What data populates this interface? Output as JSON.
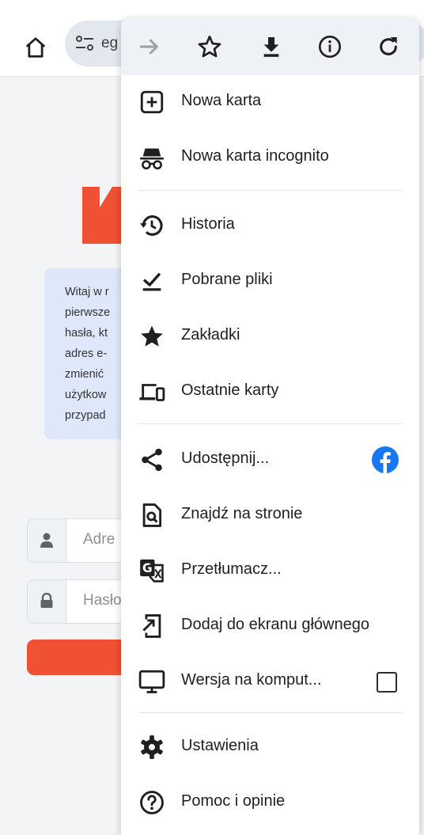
{
  "browser": {
    "url_text": "eg",
    "icons": {
      "home": "home-icon",
      "site_settings": "tune-icon",
      "forward": "arrow-forward-icon",
      "bookmark": "star-outline-icon",
      "download": "download-icon",
      "info": "info-icon",
      "reload": "reload-icon"
    }
  },
  "page": {
    "welcome_lines": [
      "Witaj w r",
      "pierwsze",
      "hasła, kt",
      "adres e-",
      "zmienić ",
      "użytkow",
      "przypad"
    ],
    "email_placeholder": "Adre",
    "password_placeholder": "Hasło",
    "brand_color": "#f05133"
  },
  "menu": {
    "items": [
      {
        "label": "Nowa karta",
        "icon": "new-tab-icon"
      },
      {
        "label": "Nowa karta incognito",
        "icon": "incognito-icon"
      },
      {
        "label": "Historia",
        "icon": "history-icon"
      },
      {
        "label": "Pobrane pliki",
        "icon": "downloads-check-icon"
      },
      {
        "label": "Zakładki",
        "icon": "star-filled-icon"
      },
      {
        "label": "Ostatnie karty",
        "icon": "devices-icon"
      },
      {
        "label": "Udostępnij...",
        "icon": "share-icon",
        "extra_icon": "facebook-icon"
      },
      {
        "label": "Znajdź na stronie",
        "icon": "find-in-page-icon"
      },
      {
        "label": "Przetłumacz...",
        "icon": "translate-icon"
      },
      {
        "label": "Dodaj do ekranu głównego",
        "icon": "add-to-home-icon"
      },
      {
        "label": "Wersja na komput...",
        "icon": "desktop-icon",
        "checked": false
      },
      {
        "label": "Ustawienia",
        "icon": "gear-icon"
      },
      {
        "label": "Pomoc i opinie",
        "icon": "help-icon"
      }
    ],
    "accent_color": "#1877f2"
  }
}
